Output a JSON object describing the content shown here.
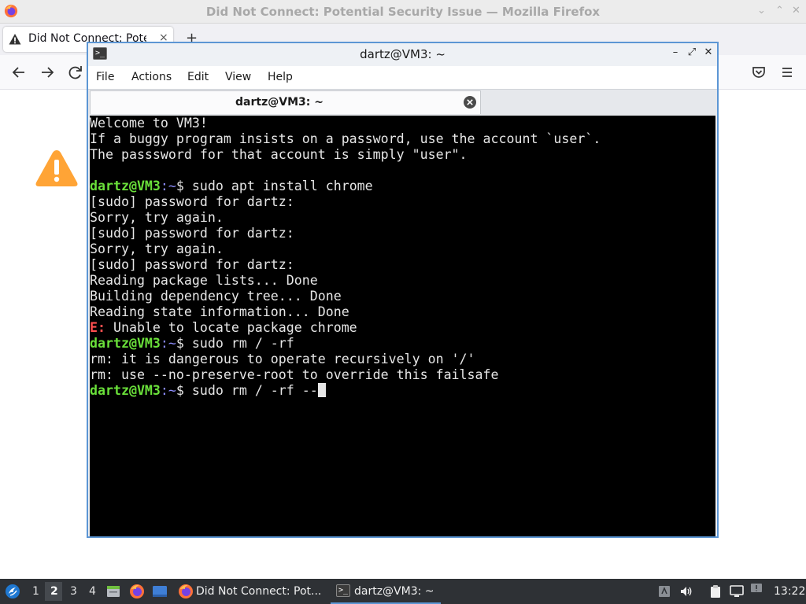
{
  "firefox": {
    "window_title": "Did Not Connect: Potential Security Issue — Mozilla Firefox",
    "tab_label": "Did Not Connect: Potential Security Issue",
    "tab_close": "×",
    "new_tab": "+"
  },
  "terminal": {
    "window_title": "dartz@VM3: ~",
    "menu": [
      "File",
      "Actions",
      "Edit",
      "View",
      "Help"
    ],
    "tab_label": "dartz@VM3: ~",
    "prompt_user": "dartz@VM3",
    "prompt_path": ":~",
    "prompt_sigil": "$ ",
    "lines": [
      {
        "type": "text",
        "text": "Welcome to VM3!"
      },
      {
        "type": "text",
        "text": "If a buggy program insists on a password, use the account `user`."
      },
      {
        "type": "text",
        "text": "The passsword for that account is simply \"user\"."
      },
      {
        "type": "text",
        "text": ""
      },
      {
        "type": "prompt",
        "text": "sudo apt install chrome"
      },
      {
        "type": "text",
        "text": "[sudo] password for dartz:"
      },
      {
        "type": "text",
        "text": "Sorry, try again."
      },
      {
        "type": "text",
        "text": "[sudo] password for dartz:"
      },
      {
        "type": "text",
        "text": "Sorry, try again."
      },
      {
        "type": "text",
        "text": "[sudo] password for dartz:"
      },
      {
        "type": "text",
        "text": "Reading package lists... Done"
      },
      {
        "type": "text",
        "text": "Building dependency tree... Done"
      },
      {
        "type": "text",
        "text": "Reading state information... Done"
      },
      {
        "type": "error",
        "tag": "E:",
        "text": " Unable to locate package chrome"
      },
      {
        "type": "prompt",
        "text": "sudo rm / -rf"
      },
      {
        "type": "text",
        "text": "rm: it is dangerous to operate recursively on '/'"
      },
      {
        "type": "text",
        "text": "rm: use --no-preserve-root to override this failsafe"
      },
      {
        "type": "prompt",
        "text": "sudo rm / -rf --",
        "cursor": true
      }
    ]
  },
  "taskbar": {
    "workspaces": [
      "1",
      "2",
      "3",
      "4"
    ],
    "active_workspace": "2",
    "tasks": [
      {
        "label": "Did Not Connect: Pot...",
        "icon": "firefox-icon"
      },
      {
        "label": "dartz@VM3: ~",
        "icon": "terminal-icon",
        "active": true
      }
    ],
    "clock": "13:22"
  },
  "colors": {
    "prompt_user": "#6ae03a",
    "prompt_path": "#8f8fff",
    "error": "#ff4f4f",
    "window_border": "#5c96d4",
    "warning": "#ffa436"
  }
}
